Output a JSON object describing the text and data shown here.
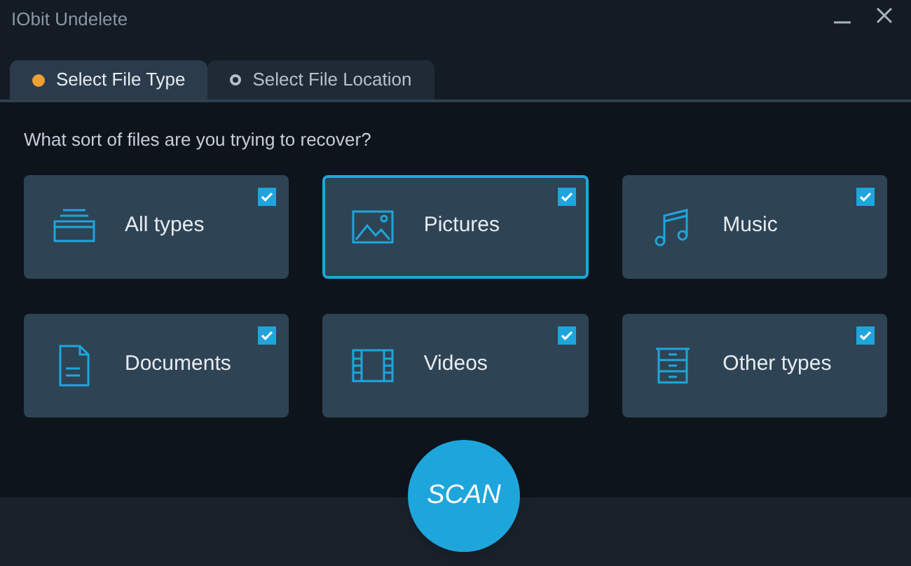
{
  "window": {
    "title": "IObit Undelete"
  },
  "tabs": [
    {
      "label": "Select File Type",
      "selected": true
    },
    {
      "label": "Select File Location",
      "selected": false
    }
  ],
  "prompt": "What sort of files are you trying to recover?",
  "file_types": [
    {
      "kind": "all",
      "label": "All types",
      "selected": false,
      "checked": true
    },
    {
      "kind": "pictures",
      "label": "Pictures",
      "selected": true,
      "checked": true
    },
    {
      "kind": "music",
      "label": "Music",
      "selected": false,
      "checked": true
    },
    {
      "kind": "documents",
      "label": "Documents",
      "selected": false,
      "checked": true
    },
    {
      "kind": "videos",
      "label": "Videos",
      "selected": false,
      "checked": true
    },
    {
      "kind": "other",
      "label": "Other types",
      "selected": false,
      "checked": true
    }
  ],
  "scan_button": "SCAN"
}
